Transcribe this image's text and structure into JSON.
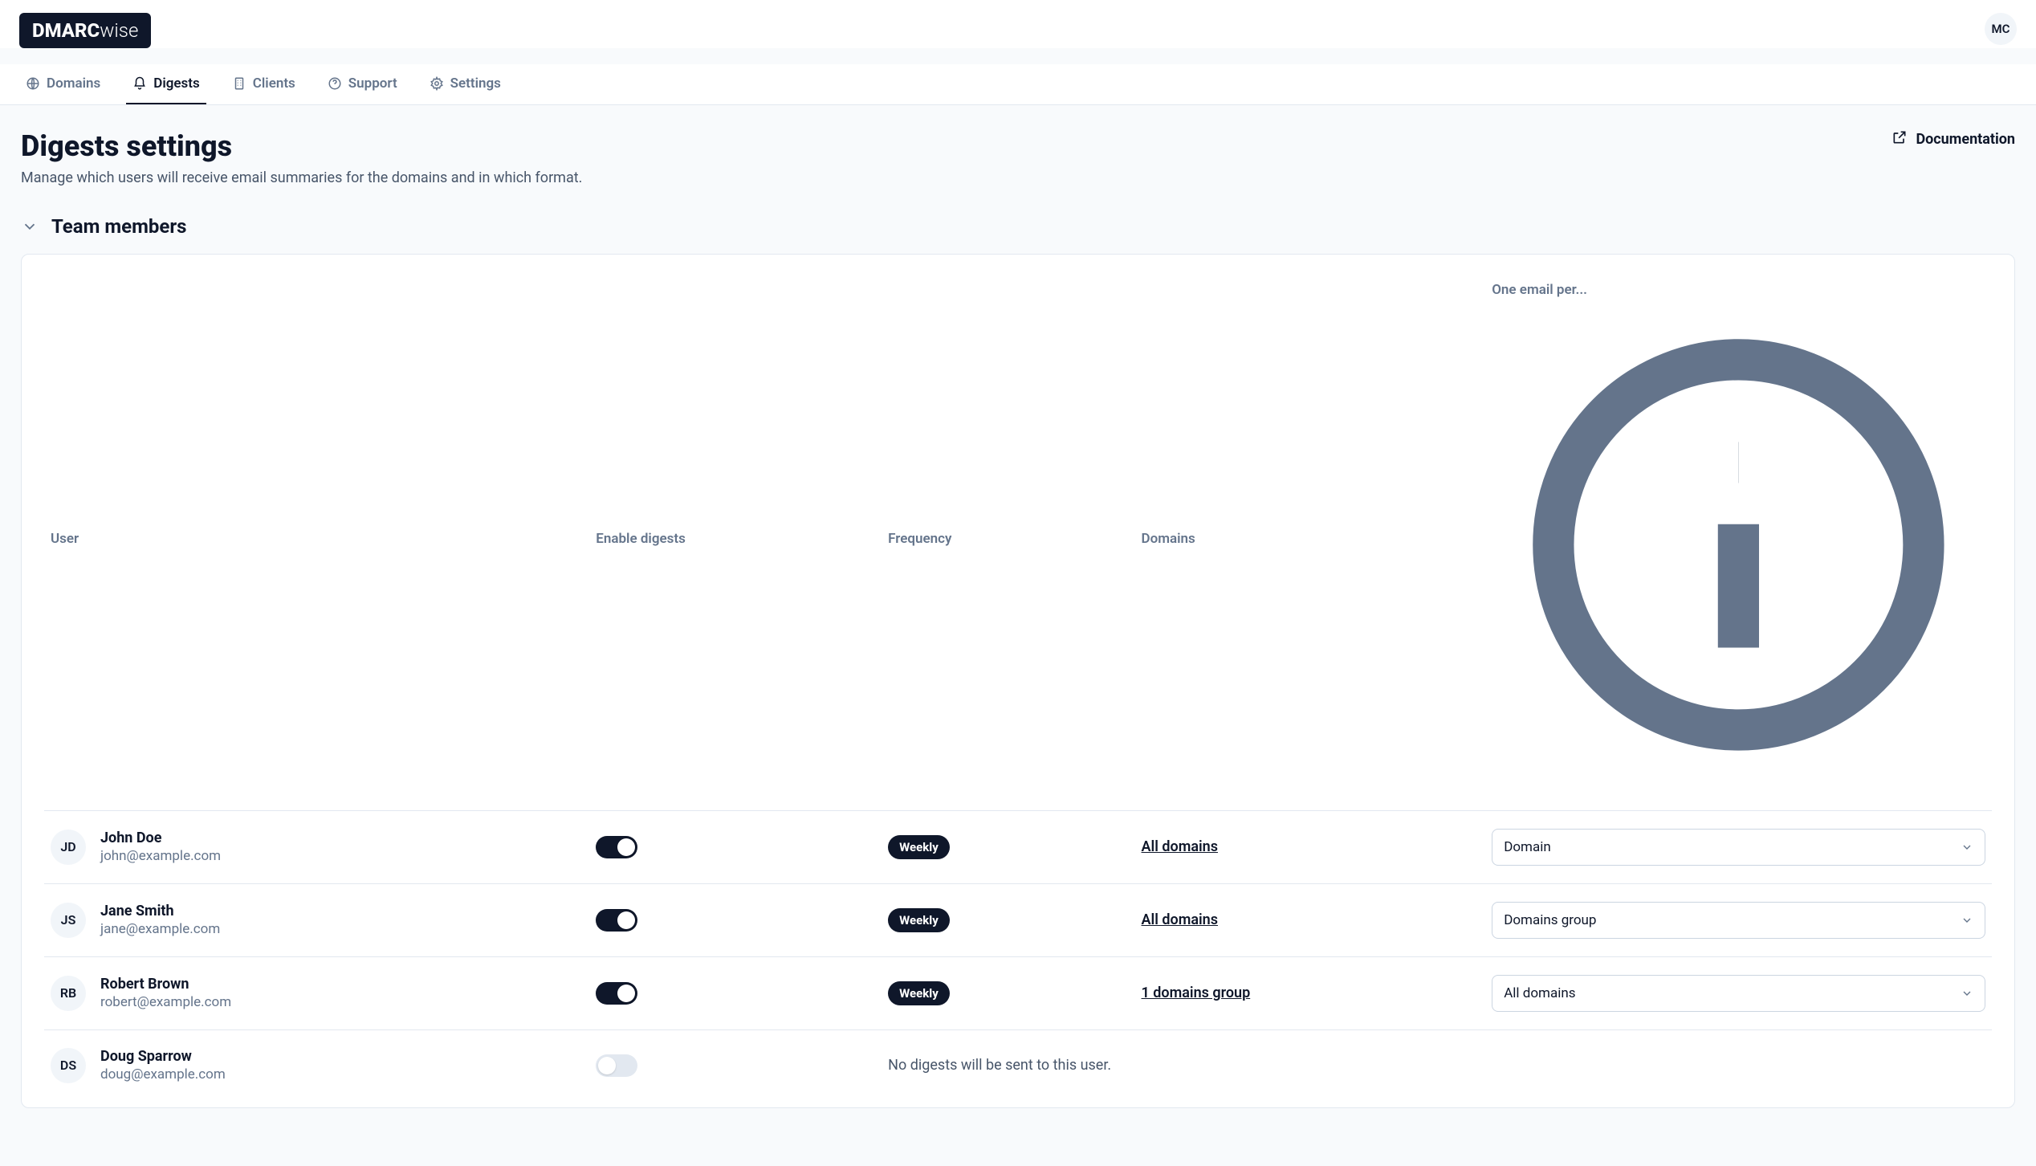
{
  "header": {
    "logo_bold": "DMARC",
    "logo_light": "wise",
    "avatar_initials": "MC"
  },
  "nav": {
    "items": [
      {
        "label": "Domains",
        "active": false
      },
      {
        "label": "Digests",
        "active": true
      },
      {
        "label": "Clients",
        "active": false
      },
      {
        "label": "Support",
        "active": false
      },
      {
        "label": "Settings",
        "active": false
      }
    ]
  },
  "page": {
    "title": "Digests settings",
    "subtitle": "Manage which users will receive email summaries for the domains and in which format.",
    "documentation_label": "Documentation"
  },
  "section": {
    "title": "Team members"
  },
  "table": {
    "headers": {
      "user": "User",
      "enable": "Enable digests",
      "frequency": "Frequency",
      "domains": "Domains",
      "one_per": "One email per..."
    },
    "rows": [
      {
        "initials": "JD",
        "name": "John Doe",
        "email": "john@example.com",
        "enabled": true,
        "frequency": "Weekly",
        "domains": "All domains",
        "one_per": "Domain"
      },
      {
        "initials": "JS",
        "name": "Jane Smith",
        "email": "jane@example.com",
        "enabled": true,
        "frequency": "Weekly",
        "domains": "All domains",
        "one_per": "Domains group"
      },
      {
        "initials": "RB",
        "name": "Robert Brown",
        "email": "robert@example.com",
        "enabled": true,
        "frequency": "Weekly",
        "domains": "1 domains group",
        "one_per": "All domains"
      },
      {
        "initials": "DS",
        "name": "Doug Sparrow",
        "email": "doug@example.com",
        "enabled": false,
        "no_digest_msg": "No digests will be sent to this user."
      }
    ]
  }
}
